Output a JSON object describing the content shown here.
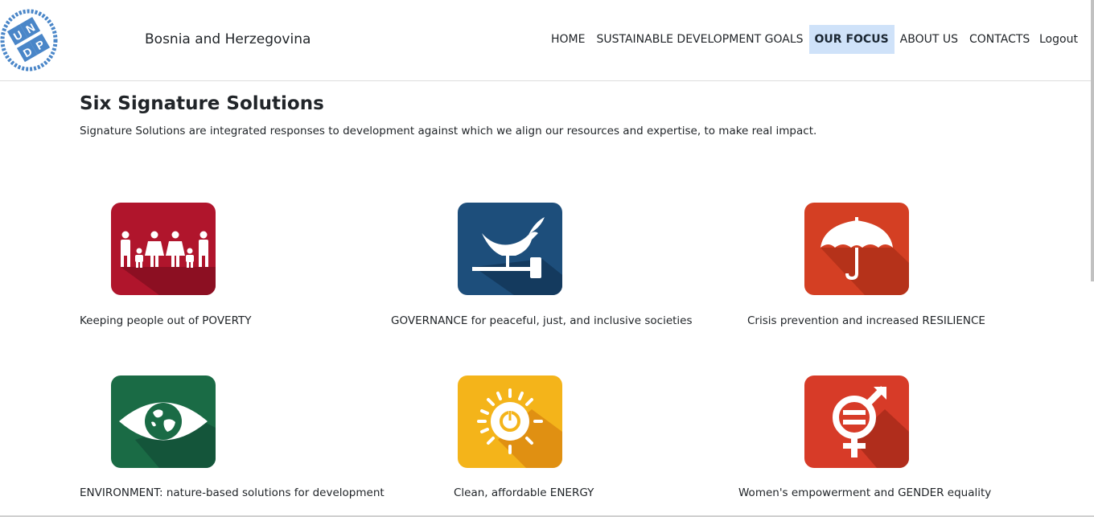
{
  "header": {
    "country": "Bosnia and Herzegovina",
    "logo_letters": [
      "U",
      "N",
      "D",
      "P"
    ]
  },
  "nav": {
    "items": [
      {
        "label": "HOME"
      },
      {
        "label": "SUSTAINABLE DEVELOPMENT GOALS"
      },
      {
        "label": "OUR FOCUS",
        "active": true
      },
      {
        "label": "ABOUT US"
      },
      {
        "label": "CONTACTS"
      }
    ],
    "logout": "Logout"
  },
  "main": {
    "title": "Six Signature Solutions",
    "description": "Signature Solutions are integrated responses to development against which we align our resources and expertise, to make real impact."
  },
  "solutions": [
    {
      "label": "Keeping people out of POVERTY",
      "icon": "family-icon",
      "color": "#b0152c"
    },
    {
      "label": "GOVERNANCE for peaceful, just, and inclusive societies",
      "icon": "dove-gavel-icon",
      "color": "#1d4e7b"
    },
    {
      "label": "Crisis prevention and increased RESILIENCE",
      "icon": "umbrella-icon",
      "color": "#d43f23"
    },
    {
      "label": "ENVIRONMENT: nature-based solutions for development",
      "icon": "eye-globe-icon",
      "color": "#1a6b45"
    },
    {
      "label": "Clean, affordable ENERGY",
      "icon": "sun-power-icon",
      "color": "#f4b41a"
    },
    {
      "label": "Women's empowerment and GENDER equality",
      "icon": "gender-equality-icon",
      "color": "#d73b28"
    }
  ]
}
